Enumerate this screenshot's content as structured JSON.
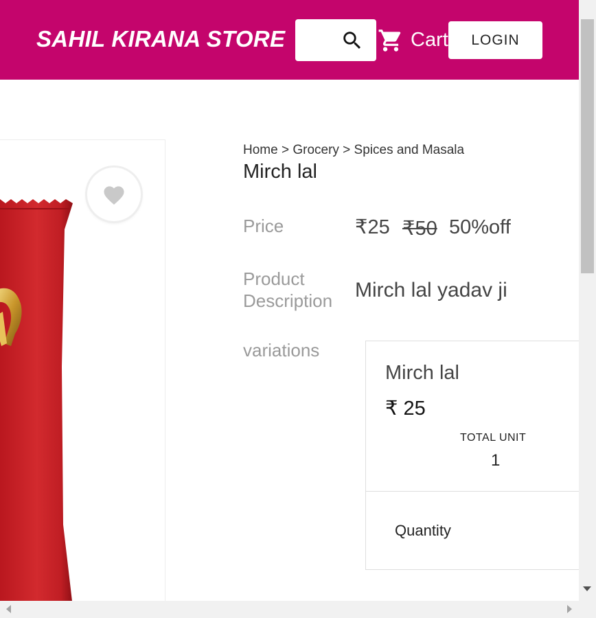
{
  "header": {
    "brand": "SAHIL KIRANA STORE",
    "search_icon": "search-icon",
    "cart_icon": "cart-icon",
    "cart_label": "Cart",
    "login_label": "LOGIN",
    "background_color": "#c4056c"
  },
  "product_image": {
    "wishlist_icon": "heart-icon"
  },
  "breadcrumb": "Home > Grocery > Spices and Masala",
  "product": {
    "title": "Mirch lal",
    "price_label": "Price",
    "price_current": "₹25",
    "price_original": "₹50",
    "discount": "50%off",
    "description_label": "Product Description",
    "description": "Mirch lal yadav ji",
    "variations_label": "variations"
  },
  "variation": {
    "name": "Mirch lal",
    "price": "₹ 25",
    "total_unit_label": "TOTAL UNIT",
    "total_unit_value": "1",
    "quantity_label": "Quantity"
  }
}
